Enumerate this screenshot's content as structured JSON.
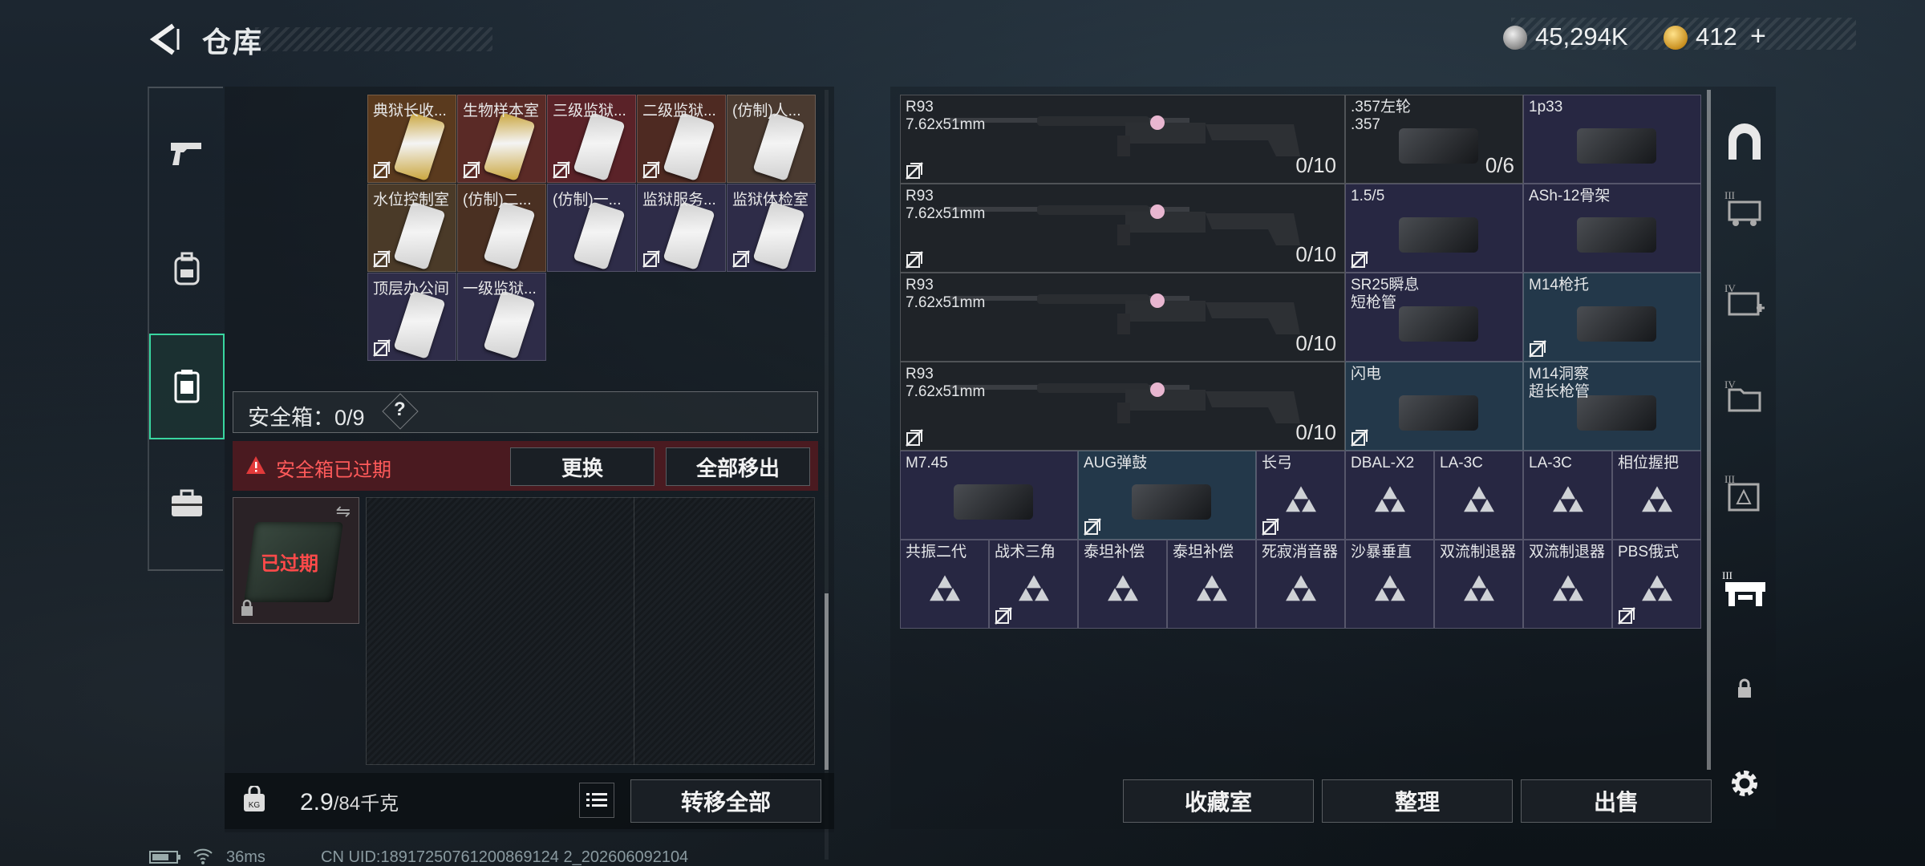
{
  "header": {
    "title": "仓库",
    "silver": "45,294K",
    "gold": "412",
    "gold_plus": "+"
  },
  "left_nav": {
    "icons": [
      "pistol-icon",
      "backpack-icon",
      "container-icon",
      "briefcase-icon"
    ],
    "active": 2
  },
  "keycards": [
    {
      "label": "典狱长收...",
      "color": "#c9a43a",
      "bg": "#5a3a1e",
      "nocopy": true
    },
    {
      "label": "生物样本室",
      "color": "#c9a43a",
      "bg": "#5a2a26",
      "nocopy": true
    },
    {
      "label": "三级监狱...",
      "color": "#d0d0d0",
      "bg": "#5a2228",
      "nocopy": true
    },
    {
      "label": "二级监狱...",
      "color": "#d0d0d0",
      "bg": "#4e2a22",
      "nocopy": true
    },
    {
      "label": "(仿制)人...",
      "color": "#d0d0d0",
      "bg": "#4a3a30",
      "nocopy": false
    },
    {
      "label": "水位控制室",
      "color": "#d0d0d0",
      "bg": "#4a3a28",
      "nocopy": true
    },
    {
      "label": "(仿制)二...",
      "color": "#d0d0d0",
      "bg": "#4a3022",
      "nocopy": false
    },
    {
      "label": "(仿制)一...",
      "color": "#d0d0d0",
      "bg": "#2e2c48",
      "nocopy": false
    },
    {
      "label": "监狱服务...",
      "color": "#d0d0d0",
      "bg": "#2e2c48",
      "nocopy": true
    },
    {
      "label": "监狱体检室",
      "color": "#d0d0d0",
      "bg": "#2e2c48",
      "nocopy": true
    },
    {
      "label": "顶层办公间",
      "color": "#d0d0d0",
      "bg": "#2e2c48",
      "nocopy": true
    },
    {
      "label": "一级监狱...",
      "color": "#d0d0d0",
      "bg": "#2e2c48",
      "nocopy": false
    }
  ],
  "safe_box": {
    "label": "安全箱：0/9",
    "help": "?",
    "expired_warning": "安全箱已过期",
    "replace_btn": "更换",
    "move_all_out_btn": "全部移出",
    "expired_tag": "已过期"
  },
  "footer_left": {
    "weight": "2.9",
    "weight_max": "/84千克",
    "transfer_all": "转移全部"
  },
  "grid_items": [
    {
      "name": "R93\n7.62x51mm",
      "count": "0/10",
      "nocopy": true,
      "bg": "#1f2328"
    },
    {
      "name": ".357左轮\n.357",
      "count": "0/6",
      "nocopy": false,
      "bg": "#1f2328"
    },
    {
      "name": "1p33",
      "count": "",
      "nocopy": false,
      "bg": "#272742"
    },
    {
      "name": "R93\n7.62x51mm",
      "count": "0/10",
      "nocopy": true,
      "bg": "#1f2328"
    },
    {
      "name": "1.5/5",
      "count": "",
      "nocopy": true,
      "bg": "#272742"
    },
    {
      "name": "ASh-12骨架",
      "count": "",
      "nocopy": false,
      "bg": "#272742"
    },
    {
      "name": "R93\n7.62x51mm",
      "count": "0/10",
      "nocopy": false,
      "bg": "#1f2328"
    },
    {
      "name": "SR25瞬息\n短枪管",
      "count": "",
      "nocopy": false,
      "bg": "#272742"
    },
    {
      "name": "M14枪托",
      "count": "",
      "nocopy": true,
      "bg": "#23384a"
    },
    {
      "name": "R93\n7.62x51mm",
      "count": "0/10",
      "nocopy": true,
      "bg": "#1f2328"
    },
    {
      "name": "闪电",
      "count": "",
      "nocopy": true,
      "bg": "#23384a"
    },
    {
      "name": "M14洞察\n超长枪管",
      "count": "",
      "nocopy": false,
      "bg": "#23384a"
    },
    {
      "name": "M7.45",
      "nocopy": false,
      "bg": "#272742"
    },
    {
      "name": "AUG弹鼓",
      "nocopy": true,
      "bg": "#23384a"
    },
    {
      "name": "长弓",
      "nocopy": true,
      "bg": "#272742"
    },
    {
      "name": "DBAL-X2",
      "nocopy": false,
      "bg": "#272742"
    },
    {
      "name": "LA-3C",
      "nocopy": false,
      "bg": "#272742"
    },
    {
      "name": "LA-3C",
      "nocopy": false,
      "bg": "#272742"
    },
    {
      "name": "相位握把",
      "nocopy": false,
      "bg": "#272742"
    },
    {
      "name": "共振二代",
      "nocopy": false,
      "bg": "#272742"
    },
    {
      "name": "战术三角",
      "nocopy": true,
      "bg": "#272742"
    },
    {
      "name": "泰坦补偿",
      "nocopy": false,
      "bg": "#272742"
    },
    {
      "name": "泰坦补偿",
      "nocopy": false,
      "bg": "#272742"
    },
    {
      "name": "死寂消音器",
      "nocopy": false,
      "bg": "#272742"
    },
    {
      "name": "沙暴垂直",
      "nocopy": false,
      "bg": "#272742"
    },
    {
      "name": "双流制退器",
      "nocopy": false,
      "bg": "#272742"
    },
    {
      "name": "双流制退器",
      "nocopy": false,
      "bg": "#272742"
    },
    {
      "name": "PBS俄式",
      "nocopy": true,
      "bg": "#272742"
    }
  ],
  "right_buttons": {
    "collection": "收藏室",
    "organize": "整理",
    "sell": "出售"
  },
  "right_nav": {
    "icons": [
      "vault-icon",
      "tier3-cart-icon",
      "tier4-medkit-icon",
      "tier4-folder-icon",
      "tier3-safe-icon",
      "tier3-workbench-icon",
      "lock-icon",
      "settings-icon"
    ]
  },
  "status_bar": {
    "ping": "36ms",
    "uid": "CN UID:18917250761200869124 2_202606092104"
  }
}
